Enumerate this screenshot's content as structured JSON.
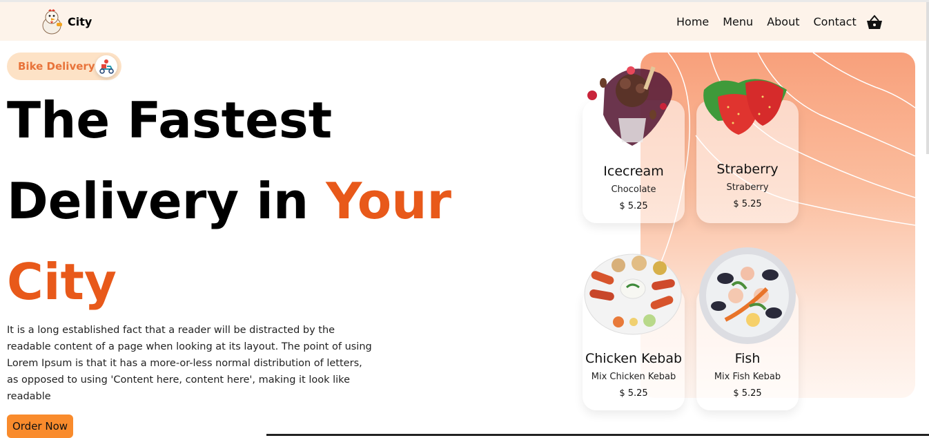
{
  "nav": {
    "brand": "City",
    "links": [
      "Home",
      "Menu",
      "About",
      "Contact"
    ]
  },
  "hero": {
    "badge": "Bike Delivery",
    "title_line1": "The Fastest",
    "title_line2_a": "Delivery in ",
    "title_line2_b": "Your",
    "title_line3": "City",
    "description": "It is a long established fact that a reader will be distracted by the readable content of a page when looking at its layout. The point of using Lorem Ipsum is that it has a more-or-less normal distribution of letters, as opposed to using 'Content here, content here', making it look like readable",
    "cta": "Order Now"
  },
  "products": [
    {
      "name": "Icecream",
      "sub": "Chocolate",
      "price": "$  5.25"
    },
    {
      "name": "Straberry",
      "sub": "Straberry",
      "price": "$  5.25"
    },
    {
      "name": "Chicken Kebab",
      "sub": "Mix Chicken Kebab",
      "price": "$  5.25"
    },
    {
      "name": "Fish",
      "sub": "Mix Fish Kebab",
      "price": "$  5.25"
    }
  ],
  "colors": {
    "accent": "#e8591a",
    "nav_bg": "#fdf3ea",
    "badge_bg": "#fde2c6",
    "cta_bg": "#f98b2c"
  },
  "icons": {
    "logo": "chicken-mascot-icon",
    "cart": "basket-icon",
    "badge": "delivery-scooter-icon"
  }
}
